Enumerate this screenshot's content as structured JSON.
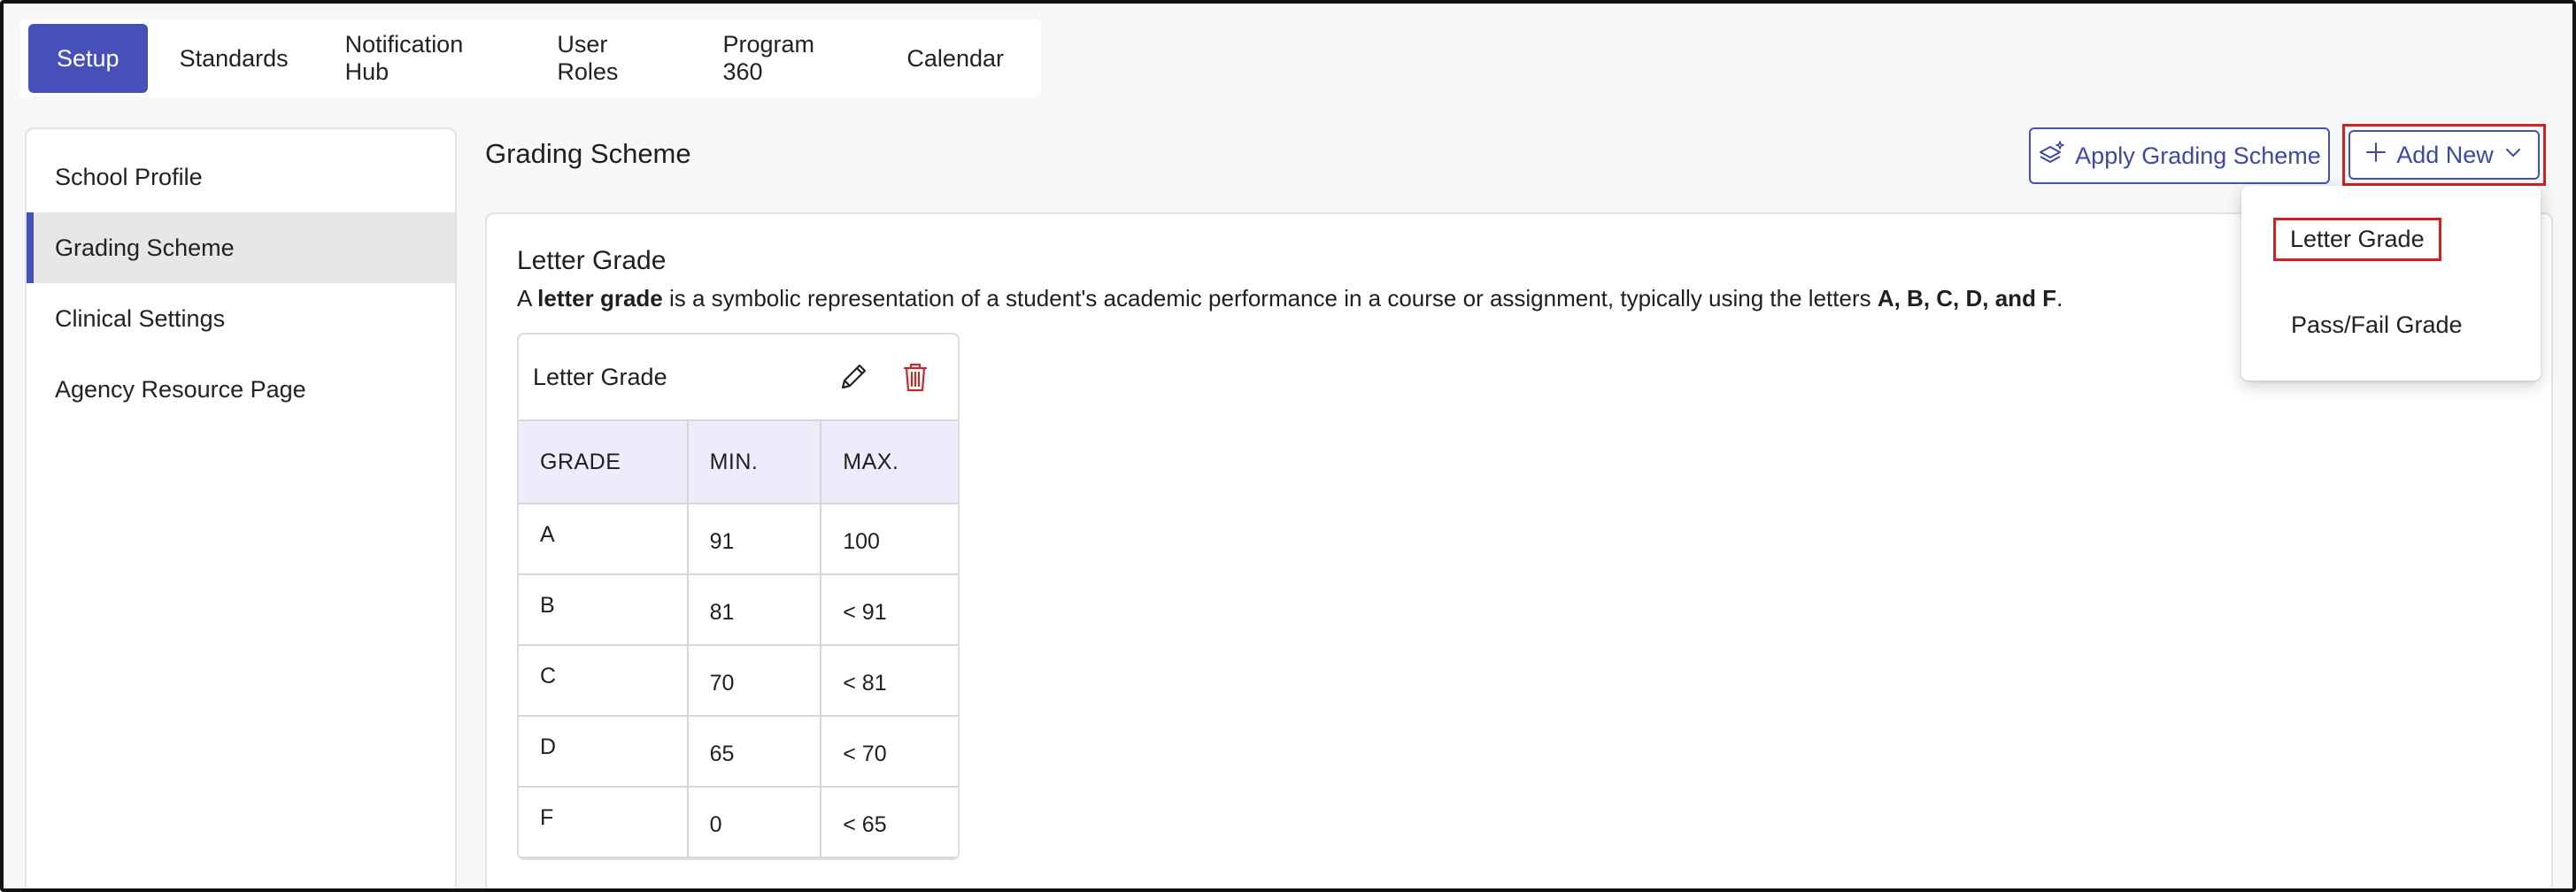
{
  "topnav": {
    "tabs": [
      {
        "label": "Setup",
        "active": true
      },
      {
        "label": "Standards",
        "active": false
      },
      {
        "label": "Notification Hub",
        "active": false
      },
      {
        "label": "User Roles",
        "active": false
      },
      {
        "label": "Program 360",
        "active": false
      },
      {
        "label": "Calendar",
        "active": false
      }
    ]
  },
  "sidebar": {
    "items": [
      {
        "label": "School Profile",
        "active": false
      },
      {
        "label": "Grading Scheme",
        "active": true
      },
      {
        "label": "Clinical Settings",
        "active": false
      },
      {
        "label": "Agency Resource Page",
        "active": false
      }
    ]
  },
  "page": {
    "title": "Grading Scheme",
    "apply_label": "Apply Grading Scheme",
    "add_label": "Add New"
  },
  "card": {
    "title": "Letter Grade",
    "desc_a": "A ",
    "desc_bold1": "letter grade",
    "desc_mid": " is a symbolic representation of a student's academic performance in a course or assignment, typically using the letters ",
    "desc_bold2": "A, B, C, D, and F",
    "desc_end": "."
  },
  "grade_table": {
    "title": "Letter Grade",
    "headers": [
      "GRADE",
      "MIN.",
      "MAX."
    ],
    "rows": [
      [
        "A",
        "91",
        "100"
      ],
      [
        "B",
        "81",
        "< 91"
      ],
      [
        "C",
        "70",
        "< 81"
      ],
      [
        "D",
        "65",
        "< 70"
      ],
      [
        "F",
        "0",
        "< 65"
      ]
    ]
  },
  "dropdown": {
    "options": [
      "Letter Grade",
      "Pass/Fail Grade"
    ]
  },
  "colors": {
    "accent": "#4650b8",
    "highlight": "#d22020",
    "table_header_bg": "#ececfb",
    "delete_icon": "#c62828"
  },
  "icons": {
    "apply": "layers-sparkle-icon",
    "add": "plus-icon",
    "chevron": "chevron-down-icon",
    "edit": "pencil-icon",
    "delete": "trash-icon"
  }
}
